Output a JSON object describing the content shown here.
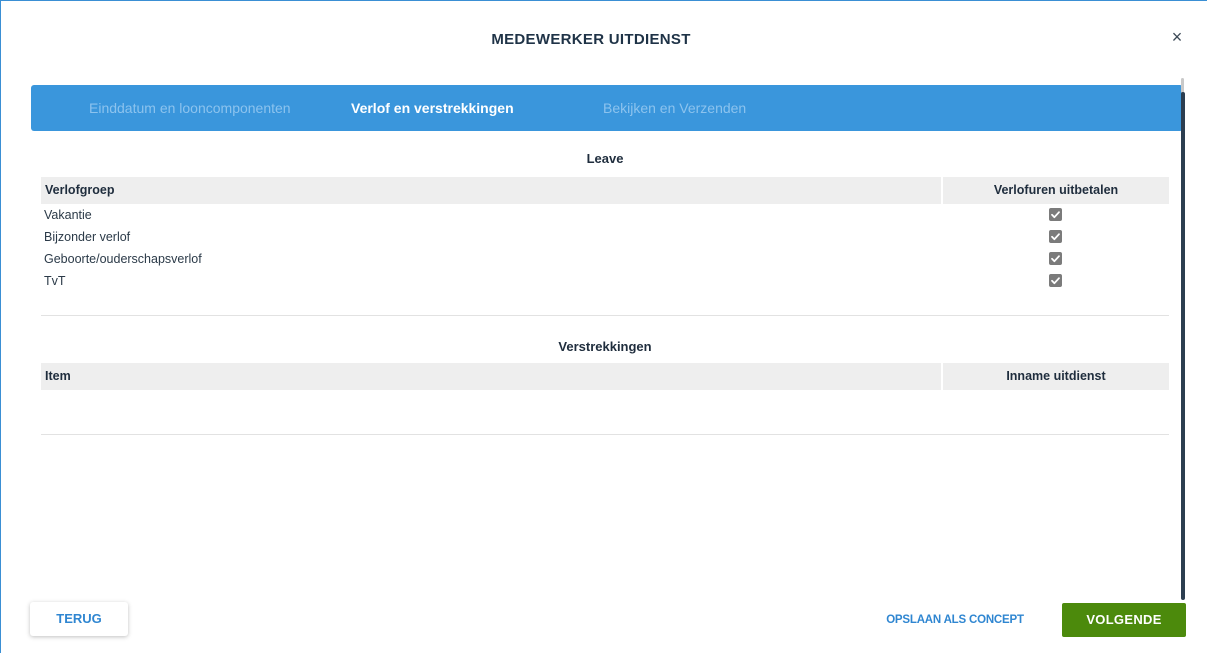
{
  "modal": {
    "title": "MEDEWERKER UITDIENST",
    "close": "×"
  },
  "steps": [
    {
      "label": "Einddatum en looncomponenten",
      "active": false
    },
    {
      "label": "Verlof en verstrekkingen",
      "active": true
    },
    {
      "label": "Bekijken en Verzenden",
      "active": false
    }
  ],
  "leave": {
    "title": "Leave",
    "columns": [
      "Verlofgroep",
      "Verlofuren uitbetalen"
    ],
    "rows": [
      {
        "label": "Vakantie",
        "checked": true
      },
      {
        "label": "Bijzonder verlof",
        "checked": true
      },
      {
        "label": "Geboorte/ouderschapsverlof",
        "checked": true
      },
      {
        "label": "TvT",
        "checked": true
      }
    ]
  },
  "verstrekkingen": {
    "title": "Verstrekkingen",
    "columns": [
      "Item",
      "Inname uitdienst"
    ],
    "rows": []
  },
  "footer": {
    "back_label": "TERUG",
    "save_label": "OPSLAAN ALS CONCEPT",
    "next_label": "VOLGENDE"
  },
  "colors": {
    "stepper_bg": "#3a96dc",
    "primary_text": "#2f86d1",
    "next_button": "#4c8a0c"
  }
}
